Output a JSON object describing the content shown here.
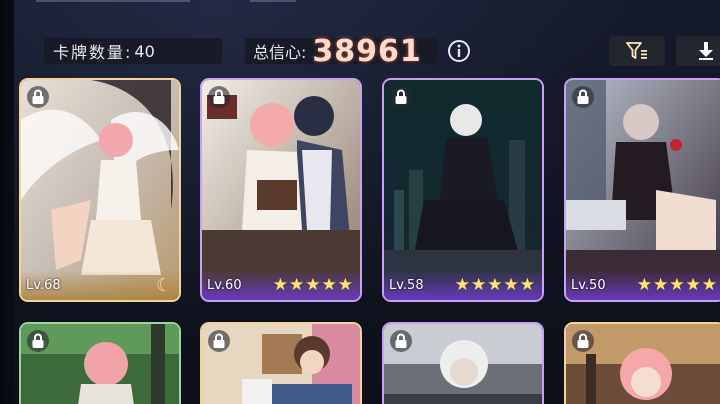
{
  "header": {
    "card_count_label": "卡牌数量:",
    "card_count_value": "40",
    "trust_label": "总信心:",
    "trust_value": "38961"
  },
  "toolbar": {
    "info_icon": "info-icon",
    "filter_icon": "filter-icon",
    "download_icon": "download-icon"
  },
  "cards": [
    {
      "level": "Lv.68",
      "stars": 0,
      "badge": "moon-icon",
      "rarity": "gold"
    },
    {
      "level": "Lv.60",
      "stars": 5,
      "rarity": "purple"
    },
    {
      "level": "Lv.58",
      "stars": 5,
      "rarity": "purple"
    },
    {
      "level": "Lv.50",
      "stars": 5,
      "rarity": "purple"
    },
    {
      "level": "",
      "rarity": "teal"
    },
    {
      "level": "",
      "rarity": "gold"
    },
    {
      "level": "",
      "rarity": "purple"
    },
    {
      "level": "",
      "rarity": "gold"
    }
  ],
  "colors": {
    "gold_border": "#f0d49b",
    "purple_border": "#c6a2f0",
    "star": "#ffe27a",
    "trust_value": "#ffd9c9"
  }
}
